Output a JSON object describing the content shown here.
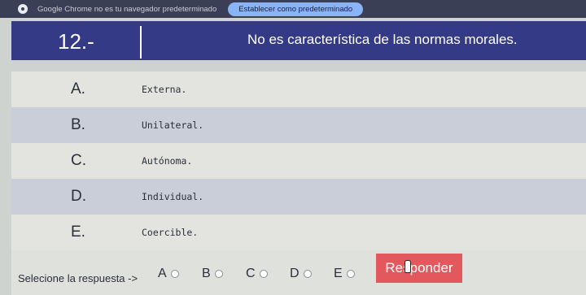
{
  "chrome_bar": {
    "message": "Google Chrome no es tu navegador predeterminado",
    "button_label": "Establecer como predeterminado"
  },
  "question": {
    "number": "12.-",
    "text": "No es característica de las normas morales."
  },
  "options": [
    {
      "letter": "A.",
      "text": "Externa."
    },
    {
      "letter": "B.",
      "text": "Unilateral."
    },
    {
      "letter": "C.",
      "text": "Autónoma."
    },
    {
      "letter": "D.",
      "text": "Individual."
    },
    {
      "letter": "E.",
      "text": "Coercible."
    }
  ],
  "answer_bar": {
    "prompt": "Selecione la respuesta ->",
    "choices": [
      "A",
      "B",
      "C",
      "D",
      "E"
    ],
    "respond_label": "Responder"
  },
  "colors": {
    "header_bg": "#343a86",
    "respond_button": "#e2585d",
    "chrome_bar": "#3b3f55"
  }
}
